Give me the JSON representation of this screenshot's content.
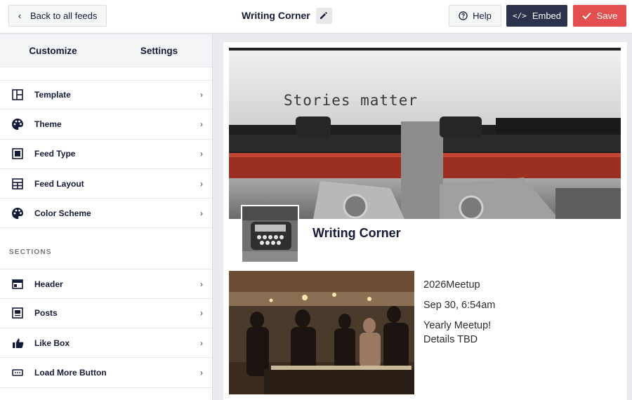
{
  "header": {
    "back_label": "Back to all feeds",
    "title": "Writing Corner",
    "help_label": "Help",
    "embed_label": "Embed",
    "embed_icon": "</>",
    "save_label": "Save"
  },
  "sidebar": {
    "tabs": [
      {
        "label": "Customize"
      },
      {
        "label": "Settings"
      }
    ],
    "items": [
      {
        "label": "Template",
        "icon": "template-icon"
      },
      {
        "label": "Theme",
        "icon": "palette-icon"
      },
      {
        "label": "Feed Type",
        "icon": "feed-type-icon"
      },
      {
        "label": "Feed Layout",
        "icon": "layout-grid-icon"
      },
      {
        "label": "Color Scheme",
        "icon": "palette-icon"
      }
    ],
    "section_title": "SECTIONS",
    "sections": [
      {
        "label": "Header",
        "icon": "header-icon"
      },
      {
        "label": "Posts",
        "icon": "posts-icon"
      },
      {
        "label": "Like Box",
        "icon": "thumbs-up-icon"
      },
      {
        "label": "Load More Button",
        "icon": "load-more-icon"
      }
    ],
    "arrow": "›"
  },
  "preview": {
    "cover_text": "Stories matter",
    "profile_name": "Writing Corner",
    "post": {
      "tag": "2026Meetup",
      "date": "Sep 30, 6:54am",
      "line1": "Yearly Meetup!",
      "line2": "Details TBD"
    }
  },
  "colors": {
    "save": "#e34f4f",
    "embed": "#2c324c",
    "text_dark": "#141b38"
  }
}
